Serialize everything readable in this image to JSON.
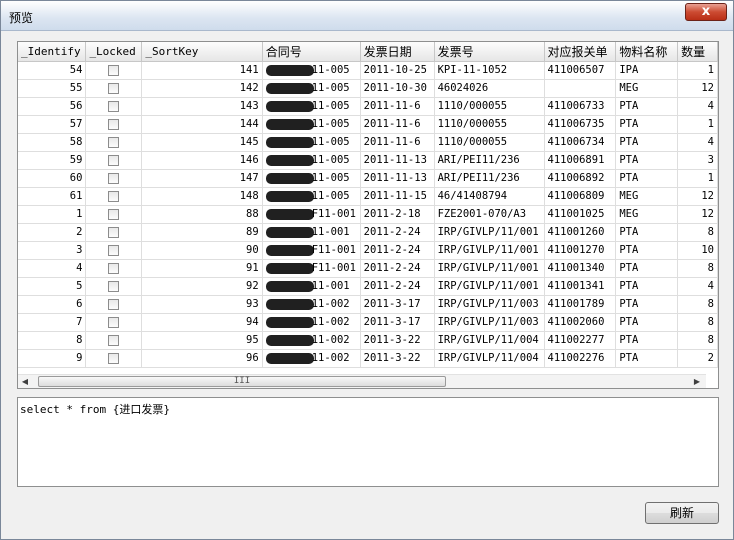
{
  "window": {
    "title": "预览",
    "close_glyph": "x"
  },
  "grid": {
    "columns": [
      "_Identify",
      "_Locked",
      "_SortKey",
      "合同号",
      "发票日期",
      "发票号",
      "对应报关单",
      "物料名称",
      "数量"
    ],
    "rows": [
      {
        "identify": "54",
        "sortkey": "141",
        "contract": "11-005",
        "date": "2011-10-25",
        "invoice": "KPI-11-1052",
        "customs": "411006507",
        "material": "IPA",
        "qty": "1"
      },
      {
        "identify": "55",
        "sortkey": "142",
        "contract": "11-005",
        "date": "2011-10-30",
        "invoice": "46024026",
        "customs": "",
        "material": "MEG",
        "qty": "12"
      },
      {
        "identify": "56",
        "sortkey": "143",
        "contract": "11-005",
        "date": "2011-11-6",
        "invoice": "1110/000055",
        "customs": "411006733",
        "material": "PTA",
        "qty": "4"
      },
      {
        "identify": "57",
        "sortkey": "144",
        "contract": "11-005",
        "date": "2011-11-6",
        "invoice": "1110/000055",
        "customs": "411006735",
        "material": "PTA",
        "qty": "1"
      },
      {
        "identify": "58",
        "sortkey": "145",
        "contract": "11-005",
        "date": "2011-11-6",
        "invoice": "1110/000055",
        "customs": "411006734",
        "material": "PTA",
        "qty": "4"
      },
      {
        "identify": "59",
        "sortkey": "146",
        "contract": "11-005",
        "date": "2011-11-13",
        "invoice": "ARI/PEI11/236",
        "customs": "411006891",
        "material": "PTA",
        "qty": "3"
      },
      {
        "identify": "60",
        "sortkey": "147",
        "contract": "11-005",
        "date": "2011-11-13",
        "invoice": "ARI/PEI11/236",
        "customs": "411006892",
        "material": "PTA",
        "qty": "1"
      },
      {
        "identify": "61",
        "sortkey": "148",
        "contract": "11-005",
        "date": "2011-11-15",
        "invoice": "46/41408794",
        "customs": "411006809",
        "material": "MEG",
        "qty": "12"
      },
      {
        "identify": "1",
        "sortkey": "88",
        "contract": "F11-001",
        "date": "2011-2-18",
        "invoice": "FZE2001-070/A3",
        "customs": "411001025",
        "material": "MEG",
        "qty": "12"
      },
      {
        "identify": "2",
        "sortkey": "89",
        "contract": "11-001",
        "date": "2011-2-24",
        "invoice": "IRP/GIVLP/11/001",
        "customs": "411001260",
        "material": "PTA",
        "qty": "8"
      },
      {
        "identify": "3",
        "sortkey": "90",
        "contract": "F11-001",
        "date": "2011-2-24",
        "invoice": "IRP/GIVLP/11/001",
        "customs": "411001270",
        "material": "PTA",
        "qty": "10"
      },
      {
        "identify": "4",
        "sortkey": "91",
        "contract": "F11-001",
        "date": "2011-2-24",
        "invoice": "IRP/GIVLP/11/001",
        "customs": "411001340",
        "material": "PTA",
        "qty": "8"
      },
      {
        "identify": "5",
        "sortkey": "92",
        "contract": "11-001",
        "date": "2011-2-24",
        "invoice": "IRP/GIVLP/11/001",
        "customs": "411001341",
        "material": "PTA",
        "qty": "4"
      },
      {
        "identify": "6",
        "sortkey": "93",
        "contract": "11-002",
        "date": "2011-3-17",
        "invoice": "IRP/GIVLP/11/003",
        "customs": "411001789",
        "material": "PTA",
        "qty": "8"
      },
      {
        "identify": "7",
        "sortkey": "94",
        "contract": "11-002",
        "date": "2011-3-17",
        "invoice": "IRP/GIVLP/11/003",
        "customs": "411002060",
        "material": "PTA",
        "qty": "8"
      },
      {
        "identify": "8",
        "sortkey": "95",
        "contract": "11-002",
        "date": "2011-3-22",
        "invoice": "IRP/GIVLP/11/004",
        "customs": "411002277",
        "material": "PTA",
        "qty": "8"
      },
      {
        "identify": "9",
        "sortkey": "96",
        "contract": "11-002",
        "date": "2011-3-22",
        "invoice": "IRP/GIVLP/11/004",
        "customs": "411002276",
        "material": "PTA",
        "qty": "2"
      }
    ]
  },
  "scrollbars": {
    "up": "▲",
    "down": "▼",
    "left": "◀",
    "right": "▶",
    "hgrip": "III"
  },
  "query": {
    "text": "select * from {进口发票}"
  },
  "buttons": {
    "refresh": "刷新"
  }
}
